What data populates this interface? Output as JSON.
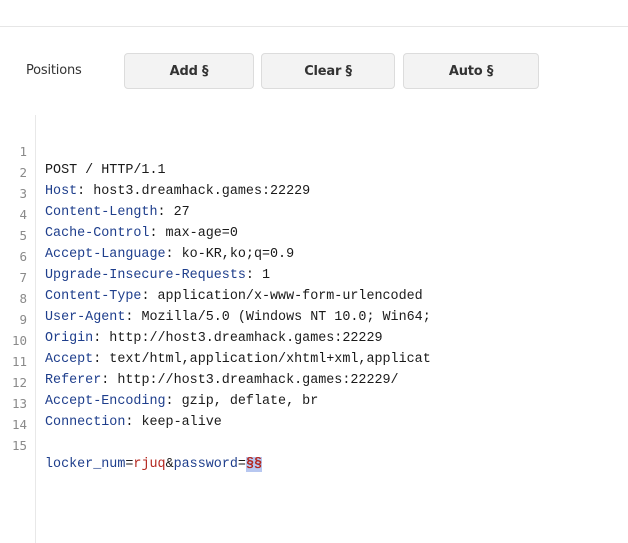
{
  "toolbar": {
    "positions_label": "Positions",
    "add_label": "Add §",
    "clear_label": "Clear §",
    "auto_label": "Auto §"
  },
  "editor": {
    "request_line": "POST / HTTP/1.1",
    "headers": [
      {
        "key": "Host",
        "value": " host3.dreamhack.games:22229"
      },
      {
        "key": "Content-Length",
        "value": " 27"
      },
      {
        "key": "Cache-Control",
        "value": " max-age=0"
      },
      {
        "key": "Accept-Language",
        "value": " ko-KR,ko;q=0.9"
      },
      {
        "key": "Upgrade-Insecure-Requests",
        "value": " 1"
      },
      {
        "key": "Content-Type",
        "value": " application/x-www-form-urlencoded"
      },
      {
        "key": "User-Agent",
        "value": " Mozilla/5.0 (Windows NT 10.0; Win64;"
      },
      {
        "key": "Origin",
        "value": " http://host3.dreamhack.games:22229"
      },
      {
        "key": "Accept",
        "value": " text/html,application/xhtml+xml,applicat"
      },
      {
        "key": "Referer",
        "value": " http://host3.dreamhack.games:22229/"
      },
      {
        "key": "Accept-Encoding",
        "value": " gzip, deflate, br"
      },
      {
        "key": "Connection",
        "value": " keep-alive"
      }
    ],
    "body": {
      "param1_key": "locker_num",
      "param1_value": "rjuq",
      "separator": "&",
      "param2_key": "password",
      "param2_marker": "§§"
    },
    "line_numbers": [
      "1",
      "2",
      "3",
      "4",
      "5",
      "6",
      "7",
      "8",
      "9",
      "10",
      "11",
      "12",
      "13",
      "14",
      "15"
    ]
  },
  "colors": {
    "header_key": "#1e3e8c",
    "param_value": "#b3261e",
    "marker_bg": "#b7c7f0"
  }
}
